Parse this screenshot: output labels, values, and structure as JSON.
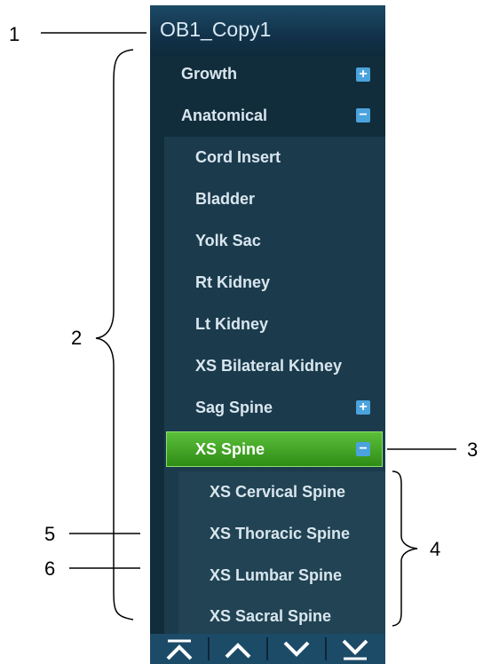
{
  "panel": {
    "title": "OB1_Copy1"
  },
  "tree": {
    "growth": {
      "label": "Growth",
      "toggle": "+"
    },
    "anatomical": {
      "label": "Anatomical",
      "toggle": "−"
    },
    "items": [
      "Cord Insert",
      "Bladder",
      "Yolk Sac",
      "Rt Kidney",
      "Lt Kidney",
      "XS Bilateral Kidney"
    ],
    "sag_spine": {
      "label": "Sag Spine",
      "toggle": "+"
    },
    "xs_spine": {
      "label": "XS Spine",
      "toggle": "−"
    },
    "sub_items": [
      "XS Cervical Spine",
      "XS Thoracic Spine",
      "XS Lumbar Spine",
      "XS Sacral Spine"
    ]
  },
  "footer": {
    "buttons": [
      "go-top-icon",
      "up-icon",
      "down-icon",
      "go-bottom-icon"
    ]
  },
  "callouts": {
    "c1": "1",
    "c2": "2",
    "c3": "3",
    "c4": "4",
    "c5": "5",
    "c6": "6"
  },
  "colors": {
    "panel": "#112c3b",
    "selected": "#3d9d22",
    "toggle": "#4aa3dd"
  }
}
